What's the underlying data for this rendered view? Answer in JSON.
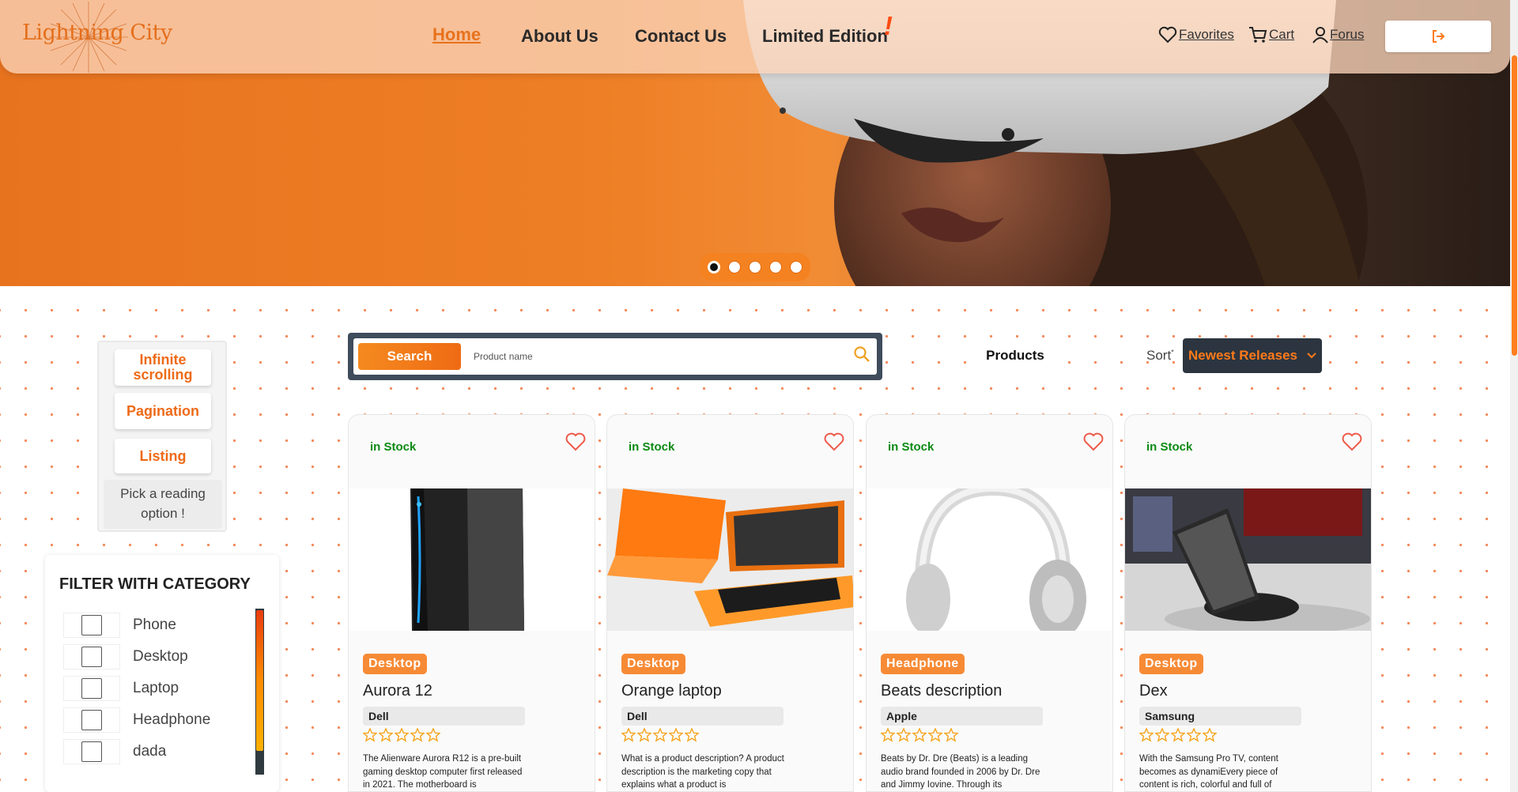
{
  "brand": {
    "logo_text": "Lightning City"
  },
  "nav": {
    "links": [
      "Home",
      "About Us",
      "Contact Us",
      "Limited Edition"
    ],
    "limited_mark": "!",
    "favorites": "Favorites",
    "cart": "Cart",
    "forum": "Forus"
  },
  "hero": {
    "slide_count": 5,
    "active_slide": 1
  },
  "reading": {
    "options": [
      "Infinite scrolling",
      "Pagination",
      "Listing"
    ],
    "hint": "Pick a reading option !"
  },
  "filter": {
    "title": "FILTER WITH CATEGORY",
    "categories": [
      "Phone",
      "Desktop",
      "Laptop",
      "Headphone",
      "dada"
    ]
  },
  "search": {
    "button": "Search",
    "placeholder": "Product name"
  },
  "toolbar": {
    "products_label": "Products",
    "sort_label": "Sort",
    "sort_value": "Newest Releases"
  },
  "colors": {
    "accent": "#F07A1E",
    "in_stock": "#0C8A14",
    "dark": "#2C353F"
  },
  "products": [
    {
      "stock": "in Stock",
      "category": "Desktop",
      "name": "Aurora 12",
      "brand": "Dell",
      "rating": 0,
      "description": "The Alienware Aurora R12 is a pre-built gaming desktop computer first released in 2021. The motherboard is"
    },
    {
      "stock": "in Stock",
      "category": "Desktop",
      "name": "Orange laptop",
      "brand": "Dell",
      "rating": 0,
      "description": "What is a product description? A product description is the marketing copy that explains what a product is"
    },
    {
      "stock": "in Stock",
      "category": "Headphone",
      "name": "Beats description",
      "brand": "Apple",
      "rating": 0,
      "description": "Beats by Dr. Dre (Beats) is a leading audio brand founded in 2006 by Dr. Dre and Jimmy Iovine. Through its"
    },
    {
      "stock": "in Stock",
      "category": "Desktop",
      "name": "Dex",
      "brand": "Samsung",
      "rating": 0,
      "description": "With the Samsung Pro TV, content becomes as dynamiEvery piece of content is rich, colorful and full of"
    }
  ]
}
